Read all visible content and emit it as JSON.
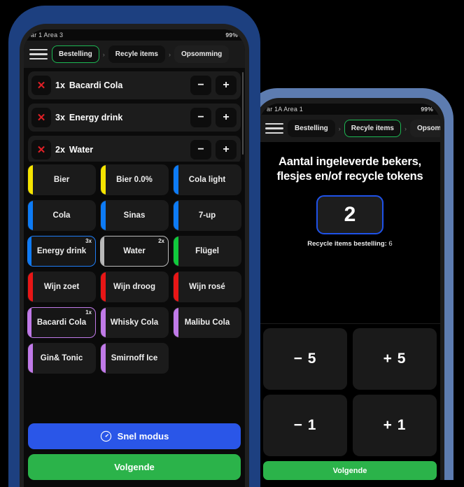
{
  "front_phone": {
    "status": {
      "left": "ar 1 Area 3",
      "right": "99%"
    },
    "nav": {
      "menu_icon": "hamburger-icon",
      "crumbs": [
        {
          "label": "Bestelling",
          "state": "active"
        },
        {
          "label": "Recyle items",
          "state": "normal"
        },
        {
          "label": "Opsomming",
          "state": "dim"
        }
      ],
      "separator": "›"
    },
    "order_rows": [
      {
        "delete": "✕",
        "qty": "1x",
        "name": "Bacardi Cola",
        "minus": "−",
        "plus": "+"
      },
      {
        "delete": "✕",
        "qty": "3x",
        "name": "Energy drink",
        "minus": "−",
        "plus": "+"
      },
      {
        "delete": "✕",
        "qty": "2x",
        "name": "Water",
        "minus": "−",
        "plus": "+"
      }
    ],
    "products": [
      {
        "label": "Bier",
        "stripe": "#f5e400",
        "border": "",
        "badge": ""
      },
      {
        "label": "Bier 0.0%",
        "stripe": "#f5e400",
        "border": "",
        "badge": ""
      },
      {
        "label": "Cola light",
        "stripe": "#0d7bf5",
        "border": "",
        "badge": ""
      },
      {
        "label": "Cola",
        "stripe": "#0d7bf5",
        "border": "",
        "badge": ""
      },
      {
        "label": "Sinas",
        "stripe": "#0d7bf5",
        "border": "",
        "badge": ""
      },
      {
        "label": "7-up",
        "stripe": "#0d7bf5",
        "border": "",
        "badge": ""
      },
      {
        "label": "Energy drink",
        "stripe": "#0d7bf5",
        "border": "#1f7df5",
        "badge": "3x"
      },
      {
        "label": "Water",
        "stripe": "#b9b9b9",
        "border": "#b9b9b9",
        "badge": "2x"
      },
      {
        "label": "Flügel",
        "stripe": "#11c93c",
        "border": "",
        "badge": ""
      },
      {
        "label": "Wijn zoet",
        "stripe": "#e81616",
        "border": "",
        "badge": ""
      },
      {
        "label": "Wijn droog",
        "stripe": "#e81616",
        "border": "",
        "badge": ""
      },
      {
        "label": "Wijn rosé",
        "stripe": "#e81616",
        "border": "",
        "badge": ""
      },
      {
        "label": "Bacardi Cola",
        "stripe": "#c07ae8",
        "border": "#c07ae8",
        "badge": "1x"
      },
      {
        "label": "Whisky Cola",
        "stripe": "#c07ae8",
        "border": "",
        "badge": ""
      },
      {
        "label": "Malibu Cola",
        "stripe": "#c07ae8",
        "border": "",
        "badge": ""
      },
      {
        "label": "Gin& Tonic",
        "stripe": "#c07ae8",
        "border": "",
        "badge": ""
      },
      {
        "label": "Smirnoff Ice",
        "stripe": "#c07ae8",
        "border": "",
        "badge": ""
      }
    ],
    "footer": {
      "fast_mode_label": "Snel modus",
      "fast_mode_icon": "speedometer-icon",
      "next_label": "Volgende"
    }
  },
  "back_phone": {
    "status": {
      "left": "ar 1A Area 1",
      "right": "99%"
    },
    "nav": {
      "menu_icon": "hamburger-icon",
      "crumbs": [
        {
          "label": "Bestelling",
          "state": "normal"
        },
        {
          "label": "Recyle items",
          "state": "active"
        },
        {
          "label": "Opsomming",
          "state": "dim"
        }
      ],
      "separator": "›"
    },
    "heading_line1": "Aantal ingeleverde bekers,",
    "heading_line2": "flesjes en/of recycle tokens",
    "counter_value": "2",
    "counter_caption": "Recycle items bestelling:",
    "counter_caption_value": " 6",
    "keypad": [
      {
        "label": "− 5"
      },
      {
        "label": "+ 5"
      },
      {
        "label": "− 1"
      },
      {
        "label": "+ 1"
      }
    ],
    "next_label": "Volgende"
  },
  "colors": {
    "frame_front": "#1d4080",
    "frame_back": "#5d7cb0",
    "accent_green": "#1db954",
    "accent_blue": "#2a56e8",
    "next_green": "#2bb34a",
    "delete_red": "#e01f26"
  }
}
